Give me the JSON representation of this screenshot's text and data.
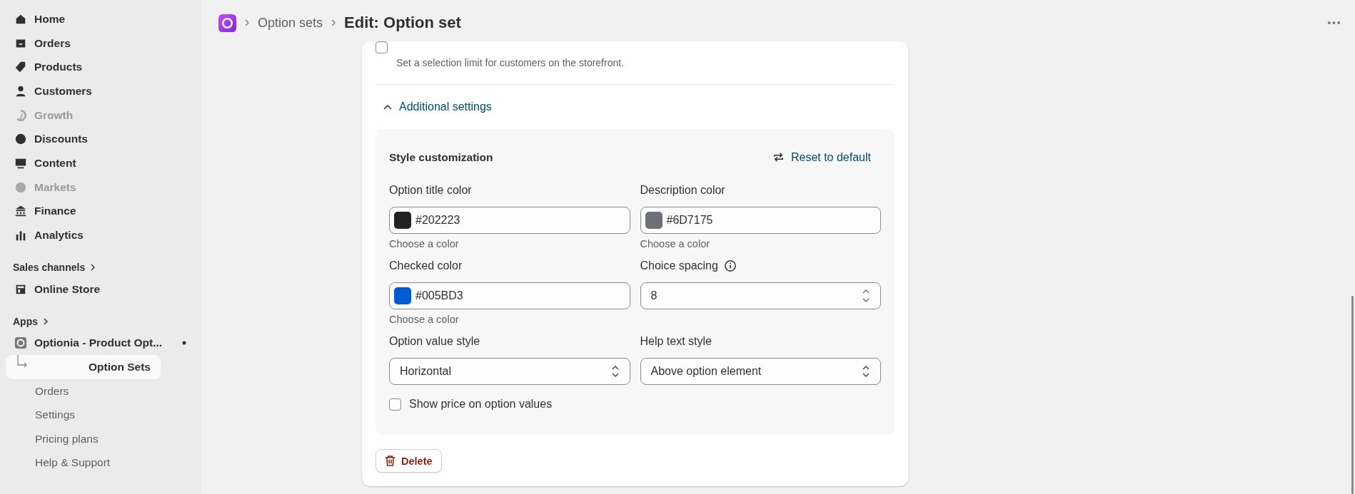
{
  "sidebar": {
    "items": [
      {
        "label": "Home",
        "disabled": false
      },
      {
        "label": "Orders",
        "disabled": false
      },
      {
        "label": "Products",
        "disabled": false
      },
      {
        "label": "Customers",
        "disabled": false
      },
      {
        "label": "Growth",
        "disabled": true
      },
      {
        "label": "Discounts",
        "disabled": false
      },
      {
        "label": "Content",
        "disabled": false
      },
      {
        "label": "Markets",
        "disabled": true
      },
      {
        "label": "Finance",
        "disabled": false
      },
      {
        "label": "Analytics",
        "disabled": false
      }
    ],
    "sales_channels": {
      "label": "Sales channels",
      "items": [
        {
          "label": "Online Store"
        }
      ]
    },
    "apps": {
      "label": "Apps",
      "app": {
        "label": "Optionia - Product Opt...",
        "children": [
          {
            "label": "Option Sets",
            "selected": true
          },
          {
            "label": "Orders",
            "selected": false
          },
          {
            "label": "Settings",
            "selected": false
          },
          {
            "label": "Pricing plans",
            "selected": false
          },
          {
            "label": "Help & Support",
            "selected": false
          }
        ]
      }
    }
  },
  "header": {
    "breadcrumb": "Option sets",
    "title": "Edit: Option set"
  },
  "card": {
    "limit_checkbox": {
      "checked": false
    },
    "limit_help": "Set a selection limit for customers on the storefront.",
    "additional_settings": {
      "label": "Additional settings",
      "expanded": true
    },
    "style_panel": {
      "title": "Style customization",
      "reset": "Reset to default",
      "fields": [
        {
          "kind": "color",
          "label": "Option title color",
          "value": "#202223",
          "color": "#202223",
          "help": "Choose a color"
        },
        {
          "kind": "color",
          "label": "Description color",
          "value": "#6D7175",
          "color": "#6d7175",
          "help": "Choose a color"
        },
        {
          "kind": "color",
          "label": "Checked color",
          "value": "#005BD3",
          "color": "#005bd3",
          "help": "Choose a color"
        },
        {
          "kind": "number",
          "label": "Choice spacing",
          "value": "8"
        },
        {
          "kind": "select",
          "label": "Option value style",
          "value": "Horizontal"
        },
        {
          "kind": "select",
          "label": "Help text style",
          "value": "Above option element"
        }
      ],
      "show_price": {
        "label": "Show price on option values",
        "checked": false
      }
    },
    "delete": "Delete"
  }
}
